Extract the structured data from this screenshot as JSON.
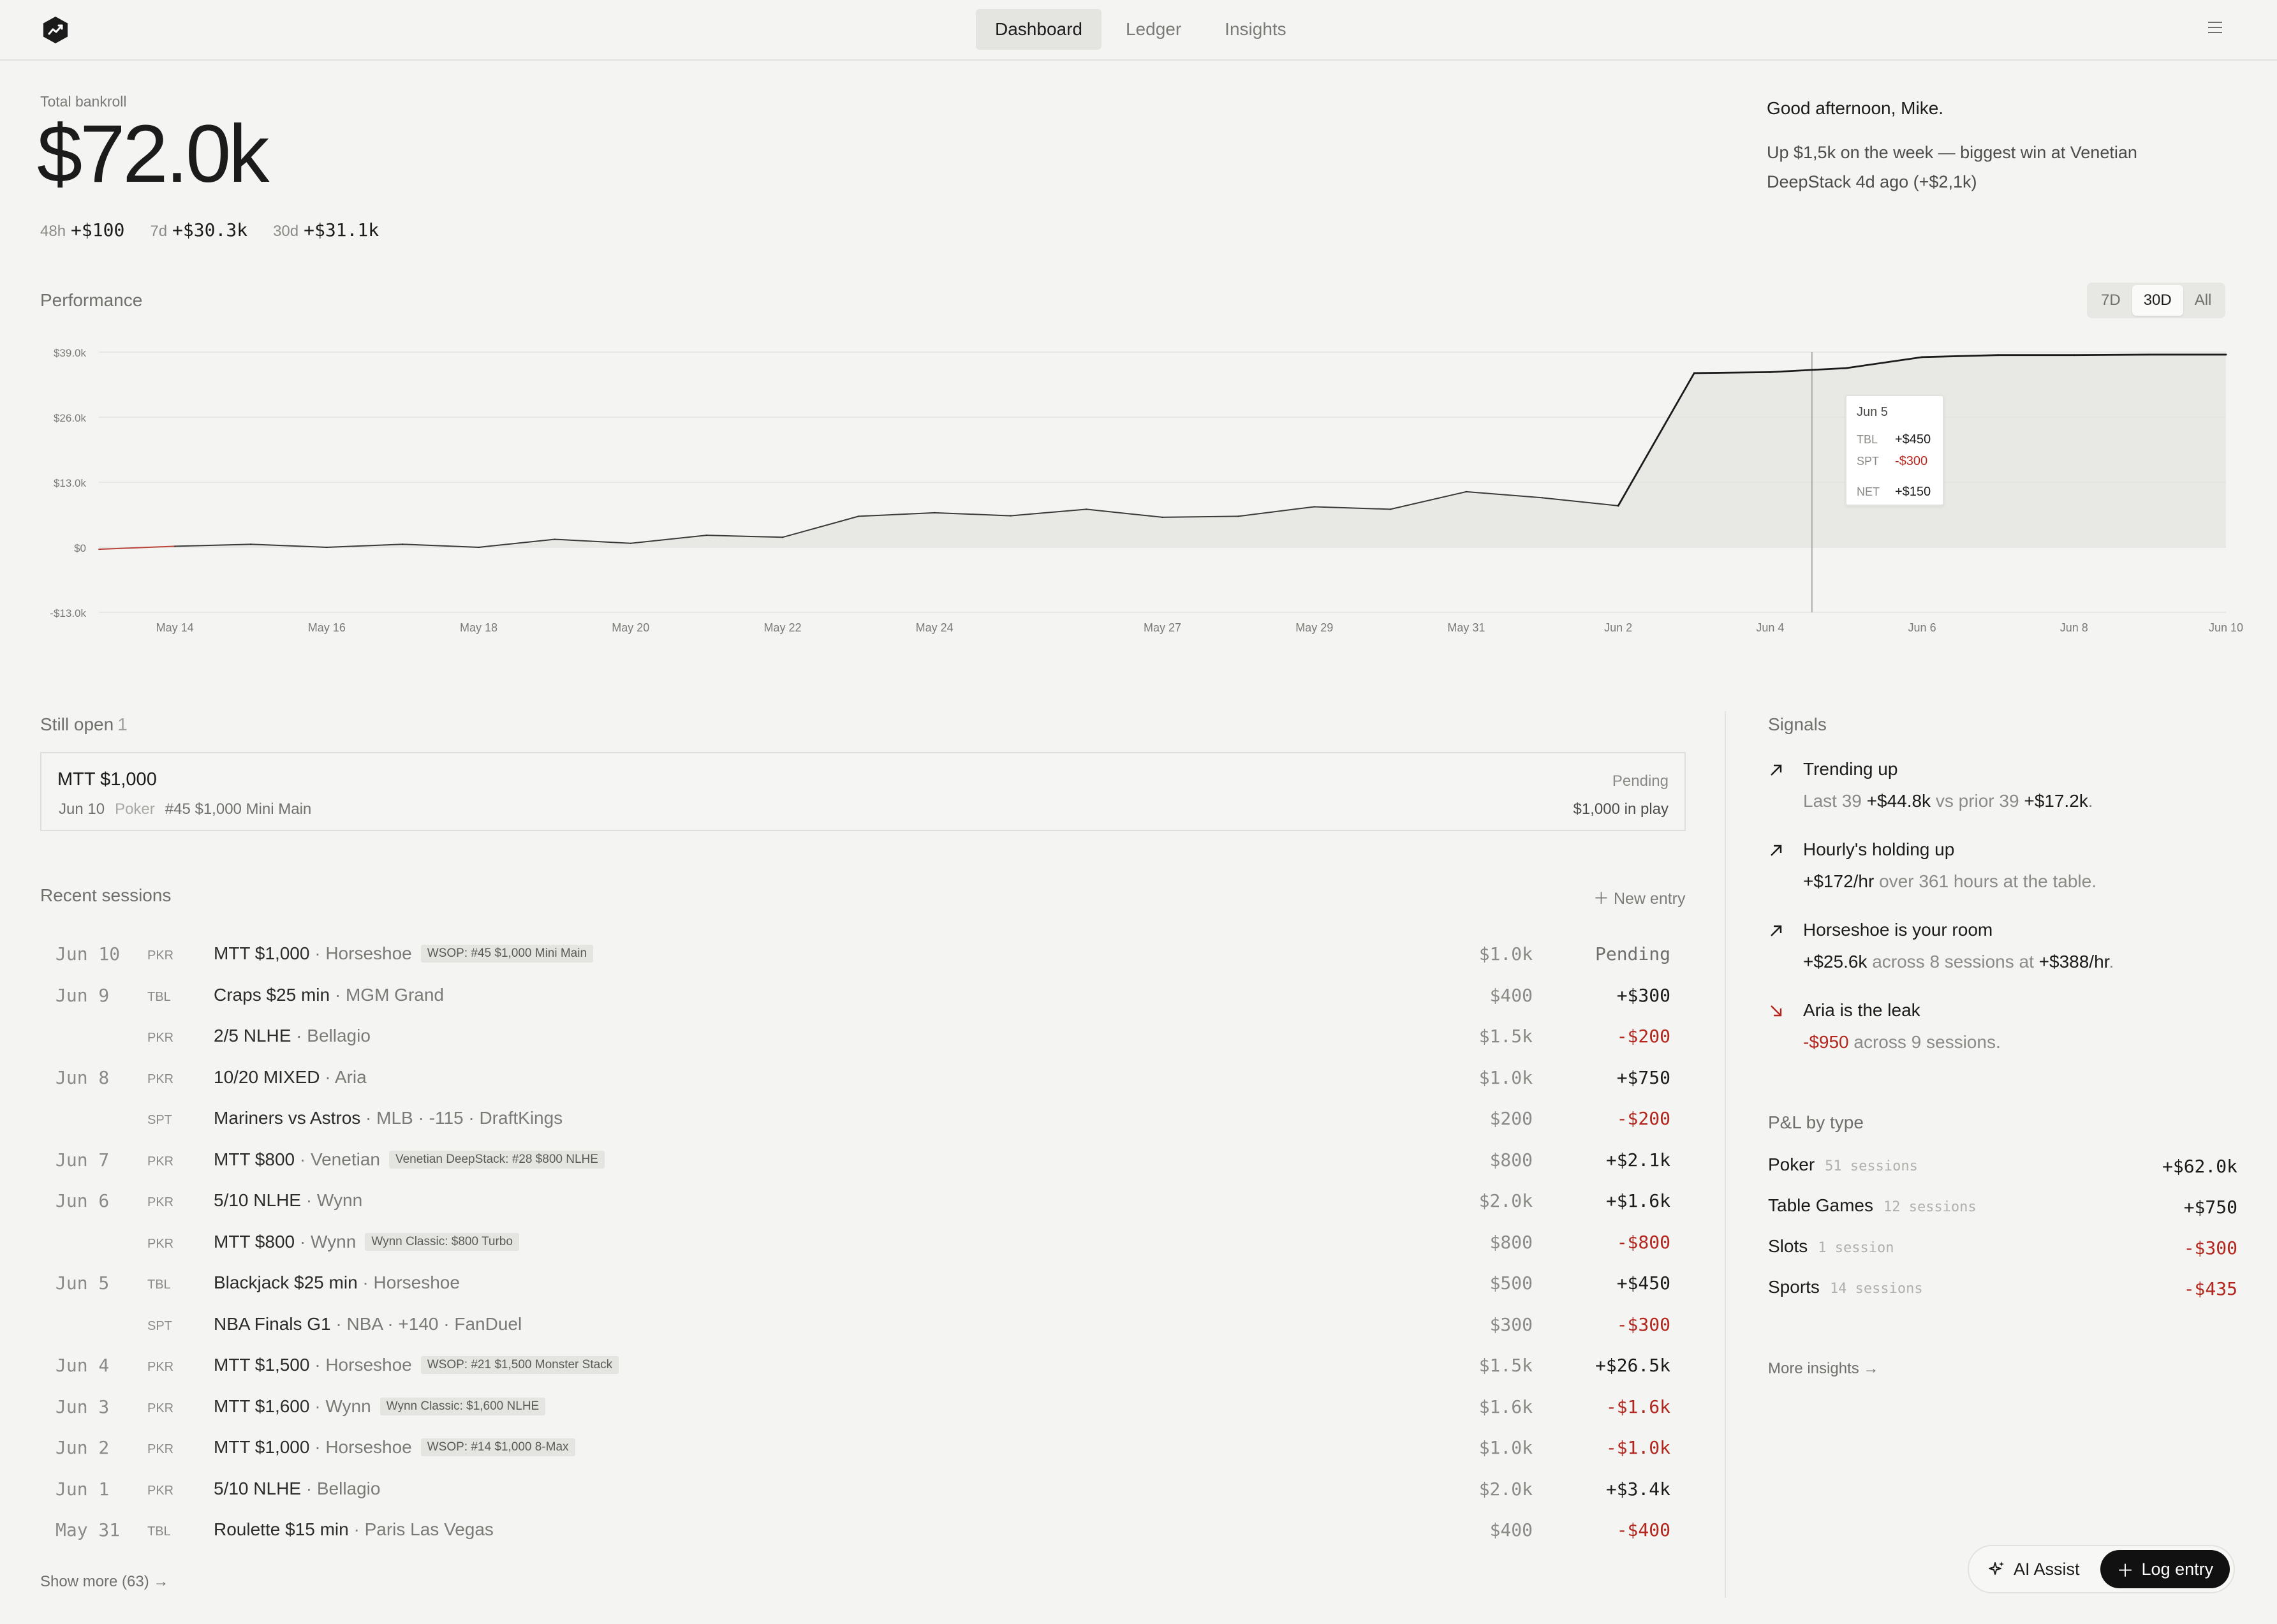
{
  "nav": {
    "tabs": [
      "Dashboard",
      "Ledger",
      "Insights"
    ],
    "active": "Dashboard"
  },
  "bankroll": {
    "label": "Total bankroll",
    "value": "$72.0k",
    "deltas": [
      {
        "period": "48h",
        "value": "+$100"
      },
      {
        "period": "7d",
        "value": "+$30.3k"
      },
      {
        "period": "30d",
        "value": "+$31.1k"
      }
    ]
  },
  "greeting": {
    "title": "Good afternoon, Mike.",
    "body": "Up $1,5k on the week — biggest win at Venetian DeepStack 4d ago (+$2,1k)"
  },
  "performance": {
    "label": "Performance",
    "ranges": [
      "7D",
      "30D",
      "All"
    ],
    "active_range": "30D",
    "tooltip": {
      "date": "Jun 5",
      "rows": [
        {
          "k": "TBL",
          "v": "+$450",
          "neg": false
        },
        {
          "k": "SPT",
          "v": "-$300",
          "neg": true
        },
        {
          "k": "NET",
          "v": "+$150",
          "neg": false
        }
      ]
    }
  },
  "chart_data": {
    "type": "area",
    "x": [
      "May 13",
      "May 14",
      "May 15",
      "May 16",
      "May 17",
      "May 18",
      "May 19",
      "May 20",
      "May 21",
      "May 22",
      "May 23",
      "May 24",
      "May 25",
      "May 26",
      "May 27",
      "May 28",
      "May 29",
      "May 30",
      "May 31",
      "Jun 1",
      "Jun 2",
      "Jun 3",
      "Jun 4",
      "Jun 5",
      "Jun 6",
      "Jun 7",
      "Jun 8",
      "Jun 9",
      "Jun 10"
    ],
    "series": [
      {
        "values": [
          -400,
          200,
          600,
          0,
          600,
          0,
          1600,
          800,
          2400,
          2000,
          6200,
          6900,
          6300,
          7600,
          6000,
          6200,
          8100,
          7600,
          11100,
          9900,
          8300,
          34800,
          35000,
          35800,
          38000,
          38400,
          38400,
          38500,
          38500
        ]
      }
    ],
    "y_ticks": [
      "$39.0k",
      "$26.0k",
      "$13.0k",
      "$0",
      "-$13.0k"
    ],
    "x_ticks": [
      "May 14",
      "May 16",
      "May 18",
      "May 20",
      "May 22",
      "May 24",
      "May 27",
      "May 29",
      "May 31",
      "Jun 2",
      "Jun 4",
      "Jun 6",
      "Jun 8",
      "Jun 10"
    ],
    "ylim": [
      -13000,
      39000
    ],
    "highlight": "Jun 5",
    "grid": true
  },
  "still_open": {
    "label": "Still open",
    "count": "1",
    "item": {
      "title": "MTT $1,000",
      "date": "Jun 10",
      "category": "Poker",
      "event": "#45 $1,000 Mini Main",
      "status": "Pending",
      "in_play": "$1,000 in play"
    }
  },
  "recent": {
    "label": "Recent sessions",
    "new_entry": "New entry",
    "show_more": "Show more (63)",
    "rows": [
      {
        "date": "Jun 10",
        "type": "PKR",
        "title": "MTT $1,000",
        "venue": " · Horseshoe",
        "tag": "WSOP: #45 $1,000 Mini Main",
        "stake": "$1.0k",
        "result": "Pending",
        "cls": "pend"
      },
      {
        "date": "Jun 9",
        "type": "TBL",
        "title": "Craps $25 min",
        "venue": " · MGM Grand",
        "tag": "",
        "stake": "$400",
        "result": "+$300",
        "cls": ""
      },
      {
        "date": "",
        "type": "PKR",
        "title": "2/5 NLHE",
        "venue": " · Bellagio",
        "tag": "",
        "stake": "$1.5k",
        "result": "-$200",
        "cls": "neg"
      },
      {
        "date": "Jun 8",
        "type": "PKR",
        "title": "10/20 MIXED",
        "venue": " · Aria",
        "tag": "",
        "stake": "$1.0k",
        "result": "+$750",
        "cls": ""
      },
      {
        "date": "",
        "type": "SPT",
        "title": "Mariners vs Astros",
        "venue": " · MLB · -115 · DraftKings",
        "tag": "",
        "stake": "$200",
        "result": "-$200",
        "cls": "neg"
      },
      {
        "date": "Jun 7",
        "type": "PKR",
        "title": "MTT $800",
        "venue": " · Venetian",
        "tag": "Venetian DeepStack: #28 $800 NLHE",
        "stake": "$800",
        "result": "+$2.1k",
        "cls": ""
      },
      {
        "date": "Jun 6",
        "type": "PKR",
        "title": "5/10 NLHE",
        "venue": " · Wynn",
        "tag": "",
        "stake": "$2.0k",
        "result": "+$1.6k",
        "cls": ""
      },
      {
        "date": "",
        "type": "PKR",
        "title": "MTT $800",
        "venue": " · Wynn",
        "tag": "Wynn Classic: $800 Turbo",
        "stake": "$800",
        "result": "-$800",
        "cls": "neg"
      },
      {
        "date": "Jun 5",
        "type": "TBL",
        "title": "Blackjack $25 min",
        "venue": " · Horseshoe",
        "tag": "",
        "stake": "$500",
        "result": "+$450",
        "cls": ""
      },
      {
        "date": "",
        "type": "SPT",
        "title": "NBA Finals G1",
        "venue": " · NBA · +140 · FanDuel",
        "tag": "",
        "stake": "$300",
        "result": "-$300",
        "cls": "neg"
      },
      {
        "date": "Jun 4",
        "type": "PKR",
        "title": "MTT $1,500",
        "venue": " · Horseshoe",
        "tag": "WSOP: #21 $1,500 Monster Stack",
        "stake": "$1.5k",
        "result": "+$26.5k",
        "cls": ""
      },
      {
        "date": "Jun 3",
        "type": "PKR",
        "title": "MTT $1,600",
        "venue": " · Wynn",
        "tag": "Wynn Classic: $1,600 NLHE",
        "stake": "$1.6k",
        "result": "-$1.6k",
        "cls": "neg"
      },
      {
        "date": "Jun 2",
        "type": "PKR",
        "title": "MTT $1,000",
        "venue": " · Horseshoe",
        "tag": "WSOP: #14 $1,000 8-Max",
        "stake": "$1.0k",
        "result": "-$1.0k",
        "cls": "neg"
      },
      {
        "date": "Jun 1",
        "type": "PKR",
        "title": "5/10 NLHE",
        "venue": " · Bellagio",
        "tag": "",
        "stake": "$2.0k",
        "result": "+$3.4k",
        "cls": ""
      },
      {
        "date": "May 31",
        "type": "TBL",
        "title": "Roulette $15 min",
        "venue": " · Paris Las Vegas",
        "tag": "",
        "stake": "$400",
        "result": "-$400",
        "cls": "neg"
      }
    ]
  },
  "signals": {
    "label": "Signals",
    "items": [
      {
        "dir": "up",
        "title": "Trending up",
        "parts": [
          [
            "Last 39 ",
            ""
          ],
          [
            "+$44.8k",
            "strong"
          ],
          [
            " vs prior 39 ",
            ""
          ],
          [
            "+$17.2k",
            "strong"
          ],
          [
            ".",
            ""
          ]
        ]
      },
      {
        "dir": "up",
        "title": "Hourly's holding up",
        "parts": [
          [
            "+$172/hr",
            "strong"
          ],
          [
            " over 361 hours at the table.",
            ""
          ]
        ]
      },
      {
        "dir": "up",
        "title": "Horseshoe is your room",
        "parts": [
          [
            "+$25.6k",
            "strong"
          ],
          [
            " across 8 sessions at ",
            ""
          ],
          [
            "+$388/hr",
            "strong"
          ],
          [
            ".",
            ""
          ]
        ]
      },
      {
        "dir": "down",
        "title": "Aria is the leak",
        "parts": [
          [
            "-$950",
            "neg"
          ],
          [
            " across 9 sessions.",
            ""
          ]
        ]
      }
    ]
  },
  "pl_by_type": {
    "label": "P&L by type",
    "rows": [
      {
        "name": "Poker",
        "count": "51 sessions",
        "value": "+$62.0k",
        "neg": false
      },
      {
        "name": "Table Games",
        "count": "12 sessions",
        "value": "+$750",
        "neg": false
      },
      {
        "name": "Slots",
        "count": "1 session",
        "value": "-$300",
        "neg": true
      },
      {
        "name": "Sports",
        "count": "14 sessions",
        "value": "-$435",
        "neg": true
      }
    ],
    "more": "More insights"
  },
  "actions": {
    "ai": "AI Assist",
    "log": "Log entry"
  },
  "colors": {
    "negative": "#b3261e",
    "accent": "#111111",
    "background": "#f4f4f2"
  }
}
